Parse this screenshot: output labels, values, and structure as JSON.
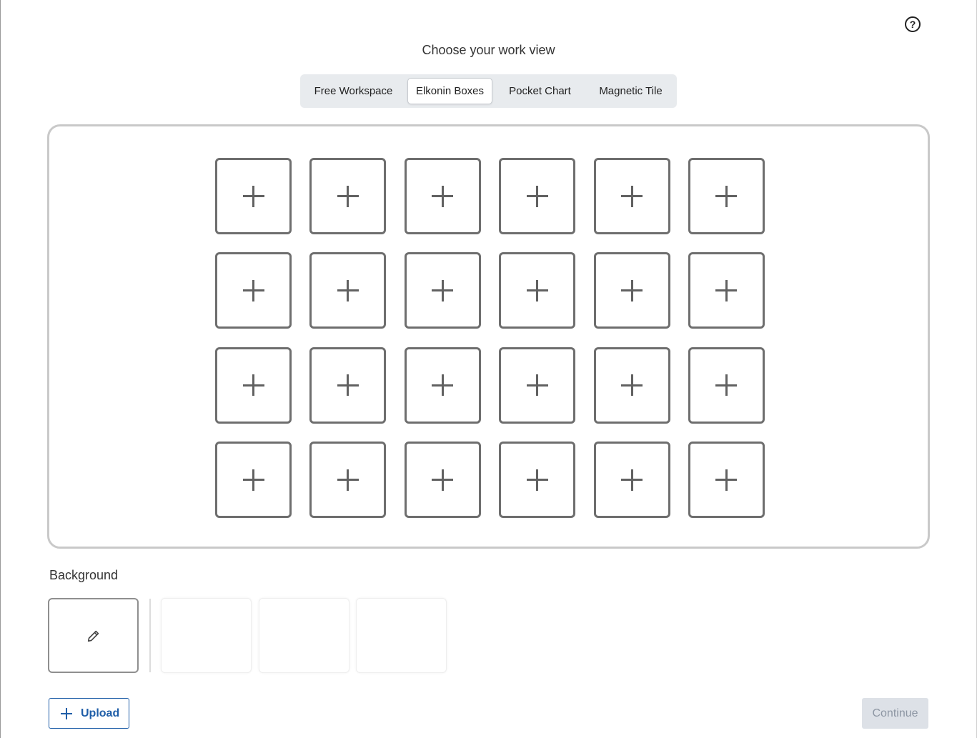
{
  "page": {
    "title": "Choose your work view",
    "help_icon": "question-circle-icon",
    "help_glyph": "?"
  },
  "tabs": [
    {
      "label": "Free Workspace",
      "active": false
    },
    {
      "label": "Elkonin Boxes",
      "active": true
    },
    {
      "label": "Pocket Chart",
      "active": false
    },
    {
      "label": "Magnetic Tile",
      "active": false
    }
  ],
  "workspace": {
    "rows": 4,
    "columns": 6,
    "box_icon": "plus-icon"
  },
  "background": {
    "label": "Background",
    "edit_icon": "pencil-icon",
    "thumbnail_count": 3
  },
  "footer": {
    "upload_label": "Upload",
    "upload_icon": "plus-icon",
    "continue_label": "Continue",
    "continue_disabled": true
  },
  "colors": {
    "accent": "#1f5ea8",
    "tab_bar_bg": "#e8ebee",
    "box_border": "#6e6e6e",
    "disabled_button_bg": "#dde1e7",
    "disabled_button_text": "#8d96a3"
  }
}
